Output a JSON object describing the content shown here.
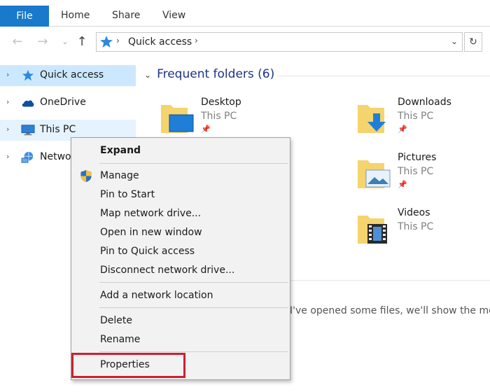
{
  "ribbon": {
    "tabs": [
      "File",
      "Home",
      "Share",
      "View"
    ]
  },
  "address": {
    "location": "Quick access",
    "refresh_glyph": "↻"
  },
  "navpane": {
    "items": [
      {
        "label": "Quick access",
        "icon": "quick-access-star-icon"
      },
      {
        "label": "OneDrive",
        "icon": "onedrive-cloud-icon"
      },
      {
        "label": "This PC",
        "icon": "this-pc-monitor-icon"
      },
      {
        "label": "Netwo",
        "icon": "network-icon"
      }
    ]
  },
  "content": {
    "group_title": "Frequent folders (6)",
    "folders": [
      {
        "name": "Desktop",
        "location": "This PC",
        "pinned": true
      },
      {
        "name": "Downloads",
        "location": "This PC",
        "pinned": true
      },
      {
        "name": "Pictures",
        "location": "This PC",
        "pinned": true
      },
      {
        "name": "Videos",
        "location": "This PC",
        "pinned": false
      }
    ],
    "recent_message": "I've opened some files, we'll show the most r"
  },
  "context_menu": {
    "items": [
      "Expand",
      "Manage",
      "Pin to Start",
      "Map network drive...",
      "Open in new window",
      "Pin to Quick access",
      "Disconnect network drive...",
      "Add a network location",
      "Delete",
      "Rename",
      "Properties"
    ],
    "highlighted": "Properties"
  },
  "colors": {
    "accent": "#1979ca",
    "selection": "#cce8ff",
    "highlight_border": "#d01f2d",
    "folder_yellow": "#f5d36d"
  }
}
